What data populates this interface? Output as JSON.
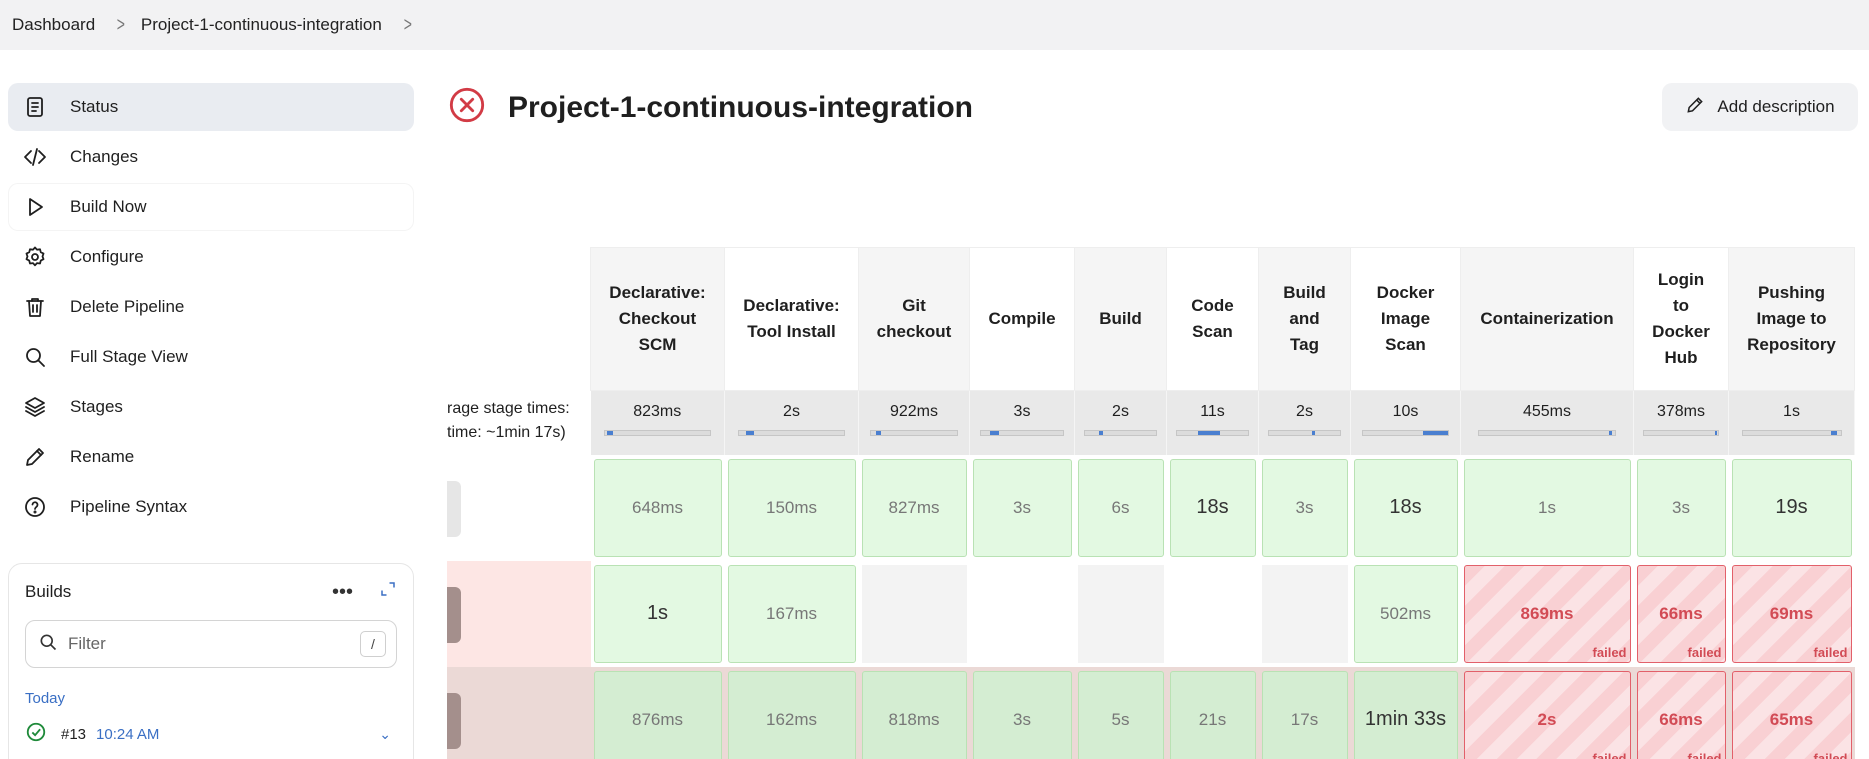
{
  "breadcrumb": {
    "items": [
      "Dashboard",
      "Project-1-continuous-integration"
    ]
  },
  "sidebar": {
    "items": [
      {
        "label": "Status",
        "icon": "document-icon"
      },
      {
        "label": "Changes",
        "icon": "code-icon"
      },
      {
        "label": "Build Now",
        "icon": "play-icon"
      },
      {
        "label": "Configure",
        "icon": "gear-icon"
      },
      {
        "label": "Delete Pipeline",
        "icon": "trash-icon"
      },
      {
        "label": "Full Stage View",
        "icon": "search-icon"
      },
      {
        "label": "Stages",
        "icon": "layers-icon"
      },
      {
        "label": "Rename",
        "icon": "pencil-icon"
      },
      {
        "label": "Pipeline Syntax",
        "icon": "help-circle-icon"
      }
    ]
  },
  "builds": {
    "title": "Builds",
    "filter_placeholder": "Filter",
    "shortcut": "/",
    "group_label": "Today",
    "latest": {
      "number": "#13",
      "time": "10:24 AM",
      "status": "success"
    }
  },
  "header": {
    "title": "Project-1-continuous-integration",
    "status": "failed",
    "add_description": "Add description"
  },
  "stage_view": {
    "avg_label_line1": "rage stage times:",
    "avg_label_line2": "time: ~1min 17s)",
    "stages": [
      {
        "name": "Declarative: Checkout SCM",
        "lines": [
          "Declarative:",
          "Checkout",
          "SCM"
        ],
        "avg": "823ms",
        "bar": [
          0.02,
          0.06
        ]
      },
      {
        "name": "Declarative: Tool Install",
        "lines": [
          "Declarative:",
          "Tool Install"
        ],
        "avg": "2s",
        "bar": [
          0.06,
          0.08
        ]
      },
      {
        "name": "Git checkout",
        "lines": [
          "Git",
          "checkout"
        ],
        "avg": "922ms",
        "bar": [
          0.06,
          0.06
        ]
      },
      {
        "name": "Compile",
        "lines": [
          "Compile"
        ],
        "avg": "3s",
        "bar": [
          0.1,
          0.12
        ]
      },
      {
        "name": "Build",
        "lines": [
          "Build"
        ],
        "avg": "2s",
        "bar": [
          0.2,
          0.06
        ]
      },
      {
        "name": "Code Scan",
        "lines": [
          "Code",
          "Scan"
        ],
        "avg": "11s",
        "bar": [
          0.3,
          0.3
        ]
      },
      {
        "name": "Build and Tag",
        "lines": [
          "Build",
          "and",
          "Tag"
        ],
        "avg": "2s",
        "bar": [
          0.6,
          0.05
        ]
      },
      {
        "name": "Docker Image Scan",
        "lines": [
          "Docker",
          "Image",
          "Scan"
        ],
        "avg": "10s",
        "bar": [
          0.7,
          0.3
        ]
      },
      {
        "name": "Containerization",
        "lines": [
          "Containerization"
        ],
        "avg": "455ms",
        "bar": [
          0.96,
          0.02
        ]
      },
      {
        "name": "Login to Docker Hub",
        "lines": [
          "Login",
          "to",
          "Docker",
          "Hub"
        ],
        "avg": "378ms",
        "bar": [
          0.96,
          0.03
        ]
      },
      {
        "name": "Pushing Image to Repository",
        "lines": [
          "Pushing",
          "Image to",
          "Repository"
        ],
        "avg": "1s",
        "bar": [
          0.9,
          0.06
        ]
      }
    ],
    "runs": [
      {
        "badge_color": "#e6e6e6",
        "cells": [
          {
            "state": "ok",
            "value": "648ms"
          },
          {
            "state": "ok",
            "value": "150ms"
          },
          {
            "state": "ok",
            "value": "827ms"
          },
          {
            "state": "ok",
            "value": "3s"
          },
          {
            "state": "ok",
            "value": "6s"
          },
          {
            "state": "ok-big",
            "value": "18s"
          },
          {
            "state": "ok",
            "value": "3s"
          },
          {
            "state": "ok-big",
            "value": "18s"
          },
          {
            "state": "ok",
            "value": "1s"
          },
          {
            "state": "ok",
            "value": "3s"
          },
          {
            "state": "ok-big",
            "value": "19s"
          }
        ]
      },
      {
        "badge_color": "#a48f8c",
        "cells": [
          {
            "state": "ok-big",
            "value": "1s"
          },
          {
            "state": "ok",
            "value": "167ms"
          },
          {
            "state": "empty-g",
            "value": ""
          },
          {
            "state": "empty-w",
            "value": ""
          },
          {
            "state": "empty-g",
            "value": ""
          },
          {
            "state": "empty-w",
            "value": ""
          },
          {
            "state": "empty-g",
            "value": ""
          },
          {
            "state": "ok",
            "value": "502ms"
          },
          {
            "state": "fail",
            "value": "869ms",
            "tag": "failed"
          },
          {
            "state": "fail",
            "value": "66ms",
            "tag": "failed"
          },
          {
            "state": "fail",
            "value": "69ms",
            "tag": "failed"
          }
        ]
      },
      {
        "badge_color": "#a48f8c",
        "cells": [
          {
            "state": "ok",
            "value": "876ms"
          },
          {
            "state": "ok",
            "value": "162ms"
          },
          {
            "state": "ok",
            "value": "818ms"
          },
          {
            "state": "ok",
            "value": "3s"
          },
          {
            "state": "ok",
            "value": "5s"
          },
          {
            "state": "ok",
            "value": "21s"
          },
          {
            "state": "ok",
            "value": "17s"
          },
          {
            "state": "ok-big",
            "value": "1min 33s"
          },
          {
            "state": "fail",
            "value": "2s",
            "tag": "failed"
          },
          {
            "state": "fail",
            "value": "66ms",
            "tag": "failed"
          },
          {
            "state": "fail",
            "value": "65ms",
            "tag": "failed"
          }
        ]
      }
    ]
  }
}
